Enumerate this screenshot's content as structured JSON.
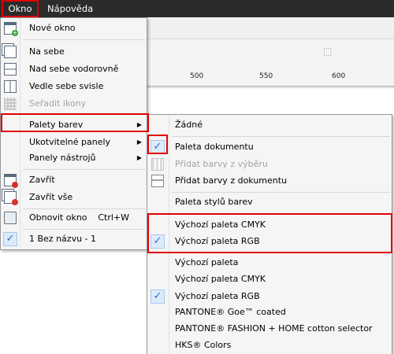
{
  "menubar": {
    "okno": "Okno",
    "napoveda": "Nápověda"
  },
  "ruler": {
    "labels": [
      "500",
      "550",
      "600"
    ]
  },
  "okno_menu": {
    "new_window": "Nové okno",
    "cascade": "Na sebe",
    "tile_horizontal": "Nad sebe vodorovně",
    "tile_vertical": "Vedle sebe svisle",
    "arrange_icons": "Seřadit ikony",
    "color_palettes": "Palety barev",
    "docked_panels": "Ukotvitelné panely",
    "toolbars": "Panely nástrojů",
    "close": "Zavřít",
    "close_all": "Zavřít vše",
    "refresh_window": "Obnovit okno",
    "refresh_shortcut": "Ctrl+W",
    "document": "1 Bez názvu - 1"
  },
  "palety_submenu": {
    "none": "Žádné",
    "document_palette": "Paleta dokumentu",
    "add_from_selection": "Přidat barvy z výběru",
    "add_from_document": "Přidat barvy z dokumentu",
    "style_palette": "Paleta stylů barev",
    "default_cmyk_1": "Výchozí paleta CMYK",
    "default_rgb_1": "Výchozí paleta RGB",
    "default_palette": "Výchozí paleta",
    "default_cmyk_2": "Výchozí paleta CMYK",
    "default_rgb_2": "Výchozí paleta RGB",
    "pantone_goe": "PANTONE® Goe™ coated",
    "pantone_fashion": "PANTONE® FASHION + HOME cotton selector",
    "hks": "HKS® Colors"
  },
  "icons": {
    "check": "checkmark-icon",
    "submenu_arrow": "chevron-right-icon",
    "arrow_glyph": "▶",
    "check_glyph": "✓"
  },
  "colors": {
    "highlight": "#e00000",
    "menubar": "#2b2b2b",
    "check_accent": "#2d6fc4"
  }
}
